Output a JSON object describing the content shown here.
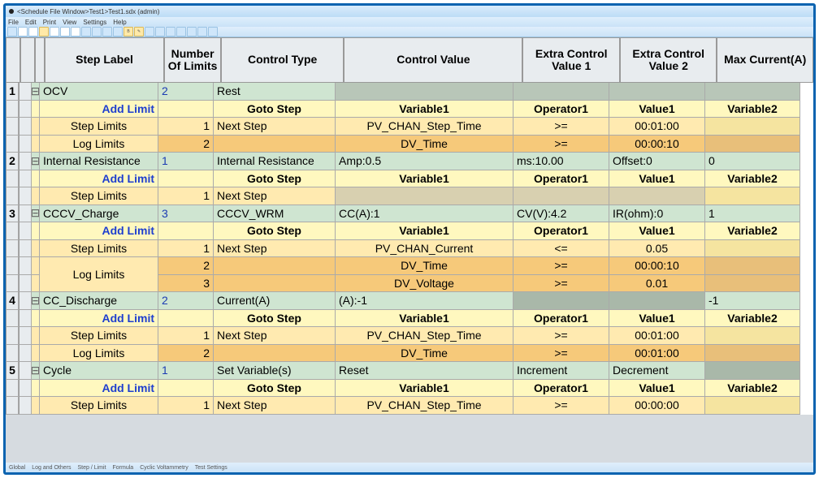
{
  "window": {
    "title": "<Schedule File Window>Test1>Test1.sdx (admin)"
  },
  "menu": [
    "File",
    "Edit",
    "Print",
    "View",
    "Settings",
    "Help"
  ],
  "columns": [
    "",
    "",
    "",
    "Step Label",
    "Number Of Limits",
    "Control Type",
    "Control Value",
    "Extra Control Value 1",
    "Extra Control Value 2",
    "Max Current(A)"
  ],
  "subhdr": {
    "addlimit": "Add Limit",
    "gotostep": "Goto Step",
    "var1": "Variable1",
    "op1": "Operator1",
    "val1": "Value1",
    "var2": "Variable2"
  },
  "labels": {
    "step_limits": "Step Limits",
    "log_limits": "Log Limits",
    "next_step": "Next Step"
  },
  "steps": [
    {
      "n": "1",
      "label": "OCV",
      "limits": "2",
      "ctype": "Rest",
      "cval": "",
      "ex1": "",
      "ex2": "",
      "max": "",
      "rows": [
        {
          "kind": "y"
        },
        {
          "kind": "l1",
          "label": "Step Limits",
          "no": "1",
          "goto": "Next Step",
          "v1": "PV_CHAN_Step_Time",
          "op": ">=",
          "val": "00:01:00",
          "v2": ""
        },
        {
          "kind": "l2",
          "label": "Log Limits",
          "no": "2",
          "goto": "",
          "v1": "DV_Time",
          "op": ">=",
          "val": "00:00:10",
          "v2": ""
        }
      ]
    },
    {
      "n": "2",
      "label": "Internal Resistance",
      "limits": "1",
      "ctype": "Internal Resistance",
      "cval": "Amp:0.5",
      "ex1": "ms:10.00",
      "ex2": "Offset:0",
      "max": "0",
      "rows": [
        {
          "kind": "y"
        },
        {
          "kind": "l1",
          "label": "Step Limits",
          "no": "1",
          "goto": "Next Step",
          "v1": "",
          "op": "",
          "val": "",
          "v2": "",
          "dim": true
        }
      ]
    },
    {
      "n": "3",
      "label": "CCCV_Charge",
      "limits": "3",
      "ctype": "CCCV_WRM",
      "cval": "CC(A):1",
      "ex1": "CV(V):4.2",
      "ex2": "IR(ohm):0",
      "max": "1",
      "rows": [
        {
          "kind": "y"
        },
        {
          "kind": "l1",
          "label": "Step Limits",
          "no": "1",
          "goto": "Next Step",
          "v1": "PV_CHAN_Current",
          "op": "<=",
          "val": "0.05",
          "v2": ""
        },
        {
          "kind": "l2",
          "span": "2",
          "label": "Log Limits",
          "no": "2",
          "goto": "",
          "v1": "DV_Time",
          "op": ">=",
          "val": "00:00:10",
          "v2": ""
        },
        {
          "kind": "l2cont",
          "no": "3",
          "goto": "",
          "v1": "DV_Voltage",
          "op": ">=",
          "val": "0.01",
          "v2": ""
        }
      ]
    },
    {
      "n": "4",
      "label": "CC_Discharge",
      "limits": "2",
      "ctype": "Current(A)",
      "cval": "(A):-1",
      "ex1": "",
      "ex2": "",
      "max": "-1",
      "darkex": true,
      "rows": [
        {
          "kind": "y"
        },
        {
          "kind": "l1",
          "label": "Step Limits",
          "no": "1",
          "goto": "Next Step",
          "v1": "PV_CHAN_Step_Time",
          "op": ">=",
          "val": "00:01:00",
          "v2": ""
        },
        {
          "kind": "l2",
          "label": "Log Limits",
          "no": "2",
          "goto": "",
          "v1": "DV_Time",
          "op": ">=",
          "val": "00:01:00",
          "v2": ""
        }
      ]
    },
    {
      "n": "5",
      "label": "Cycle",
      "limits": "1",
      "ctype": "Set Variable(s)",
      "cval": "Reset",
      "ex1": "Increment",
      "ex2": "Decrement",
      "max": "",
      "darkmax": true,
      "rows": [
        {
          "kind": "y"
        },
        {
          "kind": "l1",
          "label": "Step Limits",
          "no": "1",
          "goto": "Next Step",
          "v1": "PV_CHAN_Step_Time",
          "op": ">=",
          "val": "00:00:00",
          "v2": ""
        }
      ]
    }
  ],
  "status": [
    "Global",
    "Log and Others",
    "Step / Limit",
    "Formula",
    "Cyclic Voltammetry",
    "Test Settings"
  ]
}
